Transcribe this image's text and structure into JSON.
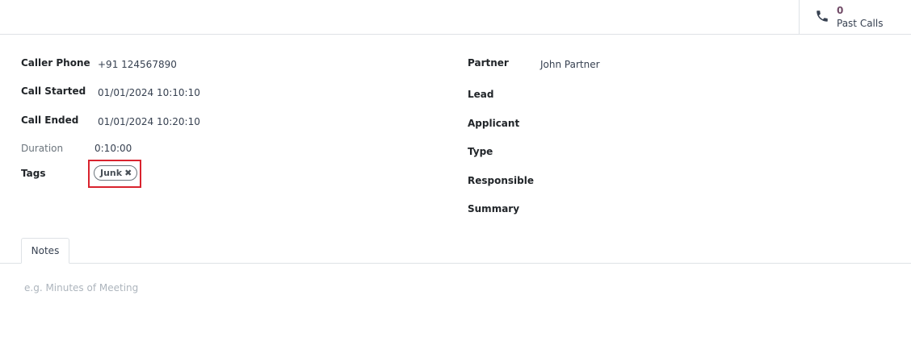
{
  "smart_button": {
    "icon": "phone-icon",
    "count": "0",
    "label": "Past Calls"
  },
  "left_fields": {
    "caller_phone": {
      "label": "Caller Phone",
      "value": "+91 124567890"
    },
    "call_started": {
      "label": "Call Started",
      "value": "01/01/2024 10:10:10"
    },
    "call_ended": {
      "label": "Call Ended",
      "value": "01/01/2024 10:20:10"
    },
    "duration": {
      "label": "Duration",
      "value": "0:10:00"
    },
    "tags": {
      "label": "Tags",
      "items": [
        {
          "name": "Junk",
          "remove_icon": "close-icon"
        }
      ]
    }
  },
  "right_fields": {
    "partner": {
      "label": "Partner",
      "value": "John Partner"
    },
    "lead": {
      "label": "Lead",
      "value": ""
    },
    "applicant": {
      "label": "Applicant",
      "value": ""
    },
    "type": {
      "label": "Type",
      "value": ""
    },
    "responsible": {
      "label": "Responsible",
      "value": ""
    },
    "summary": {
      "label": "Summary",
      "value": ""
    }
  },
  "notebook": {
    "tabs": [
      {
        "label": "Notes",
        "active": true
      }
    ],
    "notes": {
      "placeholder": "e.g. Minutes of Meeting",
      "value": ""
    }
  },
  "colors": {
    "accent": "#714b67",
    "highlight": "#d9232e",
    "border": "#dee2e6"
  }
}
